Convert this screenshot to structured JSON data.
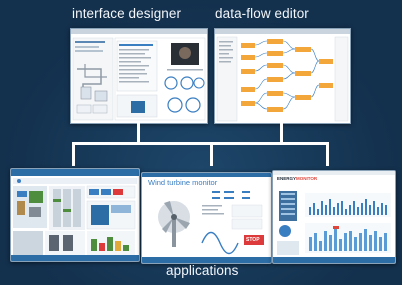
{
  "captions": {
    "interface_designer": "interface designer",
    "data_flow_editor": "data-flow editor",
    "applications": "applications"
  },
  "screens": {
    "wind_turbine_title": "Wind turbine monitor",
    "stop_label": "STOP",
    "energy_brand": "ENERGY",
    "energy_brand_accent": "MONITOR"
  },
  "colors": {
    "background": "#13304d",
    "caption": "#f3f6fa",
    "connector": "#ffffff",
    "accent_blue": "#2c6da5"
  }
}
